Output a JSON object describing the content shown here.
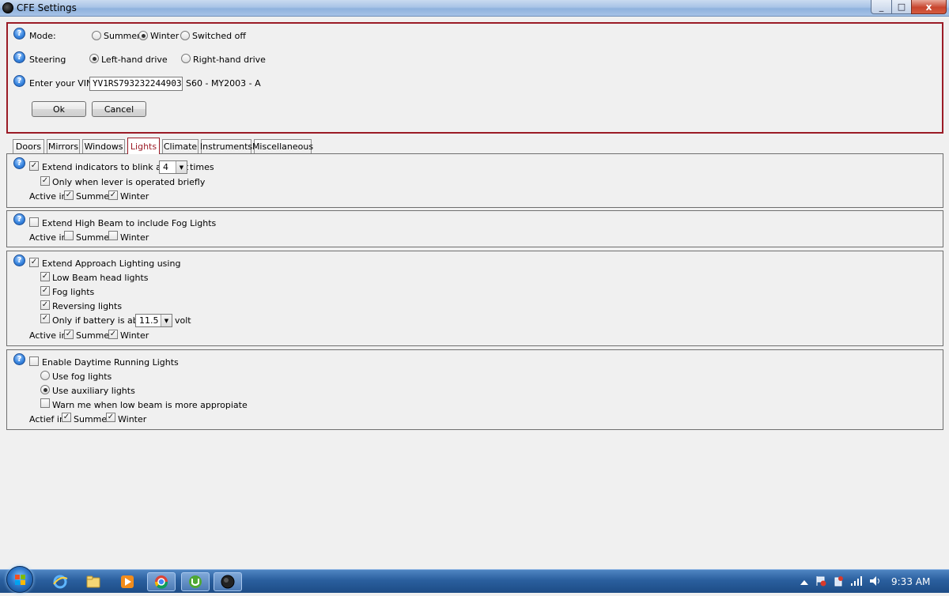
{
  "window": {
    "title": "CFE Settings",
    "close_glyph": "x",
    "minimize_glyph": "_",
    "maximize_glyph": "□"
  },
  "header": {
    "mode": {
      "label": "Mode:",
      "options": [
        "Summer",
        "Winter",
        "Switched off"
      ],
      "selected": "Winter"
    },
    "steering": {
      "label": "Steering",
      "options": [
        "Left-hand drive",
        "Right-hand drive"
      ],
      "selected": "Left-hand drive"
    },
    "vin": {
      "label": "Enter your VIN:",
      "value": "YV1RS793232244903",
      "model": "S60 - MY2003 - A"
    },
    "ok_label": "Ok",
    "cancel_label": "Cancel"
  },
  "tabs": [
    {
      "label": "Doors"
    },
    {
      "label": "Mirrors"
    },
    {
      "label": "Windows"
    },
    {
      "label": "Lights",
      "active": true
    },
    {
      "label": "Climate"
    },
    {
      "label": "Instruments"
    },
    {
      "label": "Miscellaneous"
    }
  ],
  "lights": {
    "indicators": {
      "label": "Extend indicators to blink at least",
      "checked": true,
      "count": "4",
      "count_suffix": "times",
      "sub_label": "Only when lever is operated briefly",
      "sub_checked": true,
      "active_in": "Active in",
      "summer": "Summer",
      "winter": "Winter",
      "summer_checked": true,
      "winter_checked": true
    },
    "high_beam": {
      "label": "Extend High Beam to include Fog Lights",
      "checked": false,
      "active_in": "Active in",
      "summer": "Summer",
      "winter": "Winter",
      "summer_checked": false,
      "winter_checked": false
    },
    "approach": {
      "label": "Extend Approach Lighting using",
      "checked": true,
      "items": [
        "Low Beam head lights",
        "Fog lights",
        "Reversing lights",
        "Only if battery is above"
      ],
      "voltage": "11.5",
      "voltage_suffix": "volt",
      "active_in": "Active in",
      "summer": "Summer",
      "winter": "Winter",
      "summer_checked": true,
      "winter_checked": true
    },
    "drl": {
      "label": "Enable Daytime Running Lights",
      "checked": false,
      "options": [
        "Use fog lights",
        "Use auxiliary lights"
      ],
      "selected": "Use auxiliary lights",
      "warn_label": "Warn me when low beam is more appropiate",
      "warn_checked": false,
      "active_in": "Actief in",
      "summer": "Summer",
      "winter": "Winter",
      "summer_checked": true,
      "winter_checked": true
    }
  },
  "taskbar": {
    "clock": "9:33 AM",
    "icons": [
      "start-orb",
      "ie-icon",
      "explorer-icon",
      "media-player-icon",
      "chrome-icon",
      "utorrent-icon",
      "cfe-app-icon"
    ]
  },
  "glyphs": {
    "check": "✓",
    "help": "?",
    "dropdown": "▼"
  }
}
